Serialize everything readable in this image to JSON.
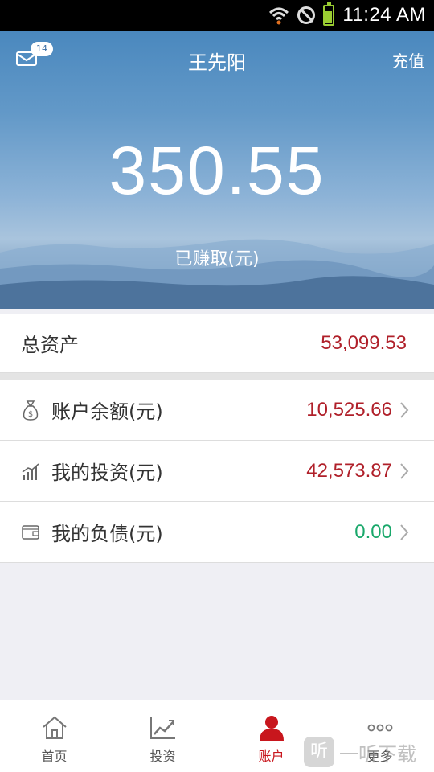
{
  "status_bar": {
    "time": "11:24 AM"
  },
  "header": {
    "title": "王先阳",
    "recharge": "充值",
    "mail_badge": "14"
  },
  "hero": {
    "amount": "350.55",
    "label": "已赚取(元)"
  },
  "summary": {
    "total_assets": {
      "label": "总资产",
      "value": "53,099.53"
    },
    "rows": [
      {
        "label": "账户余额(元)",
        "value": "10,525.66",
        "icon": "money-bag-icon",
        "color": "#b0202a"
      },
      {
        "label": "我的投资(元)",
        "value": "42,573.87",
        "icon": "bar-chart-icon",
        "color": "#b0202a"
      },
      {
        "label": "我的负债(元)",
        "value": "0.00",
        "icon": "wallet-icon",
        "color": "#1aa86b"
      }
    ]
  },
  "nav": [
    {
      "label": "首页",
      "icon": "home-icon"
    },
    {
      "label": "投资",
      "icon": "trend-chart-icon"
    },
    {
      "label": "账户",
      "icon": "user-icon",
      "active": true
    },
    {
      "label": "更多",
      "icon": "more-icon"
    }
  ],
  "watermark": {
    "logo": "听",
    "text": "一听下载"
  },
  "colors": {
    "accent_red": "#c8161d",
    "value_red": "#b0202a",
    "value_green": "#1aa86b"
  }
}
